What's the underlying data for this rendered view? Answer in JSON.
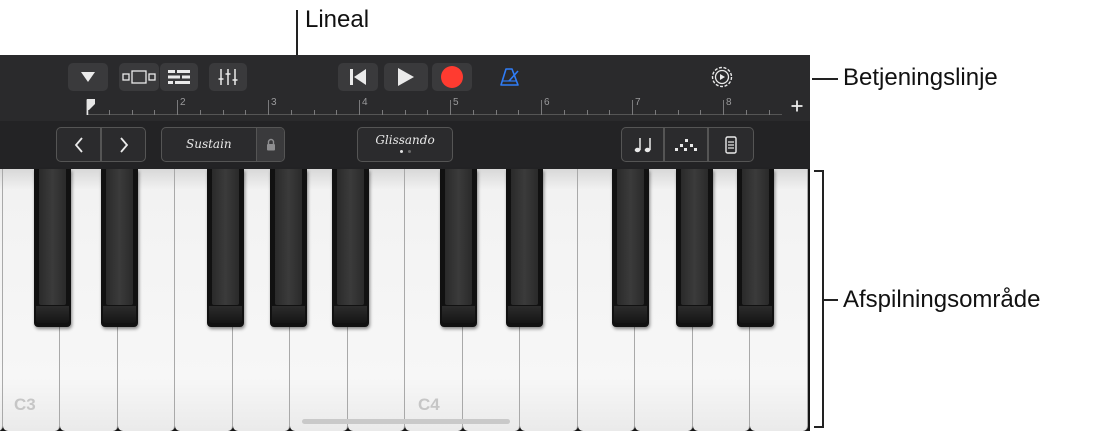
{
  "callouts": {
    "ruler": "Lineal",
    "control_bar": "Betjeningslinje",
    "playing_area": "Afspilningsområde"
  },
  "icons": {
    "browser": "triangle-down-icon",
    "view": "view-toggle-icon",
    "tracks": "tracks-view-icon",
    "mixer": "mixer-sliders-icon",
    "rewind": "go-to-beginning-icon",
    "play": "play-icon",
    "record": "record-icon",
    "metronome": "metronome-icon",
    "settings": "gear-icon",
    "add": "plus-icon",
    "octave_down": "chevron-left-icon",
    "octave_up": "chevron-right-icon",
    "lock": "lock-icon",
    "notes": "notes-icon",
    "arpeggiator": "arpeggiator-icon",
    "keyboard_size": "keyboard-layout-icon"
  },
  "ruler": {
    "bars": [
      "2",
      "3",
      "4",
      "5",
      "6",
      "7",
      "8"
    ]
  },
  "key_controls": {
    "sustain_label": "Sustain",
    "glissando_label": "Glissando"
  },
  "keyboard": {
    "labels": {
      "c3": "C3",
      "c4": "C4"
    }
  },
  "colors": {
    "record": "#ff3b30",
    "metronome_active": "#2f7cf6",
    "control_bar_bg": "#2a2a2c",
    "white_key": "#f5f5f5",
    "black_key": "#111111"
  }
}
